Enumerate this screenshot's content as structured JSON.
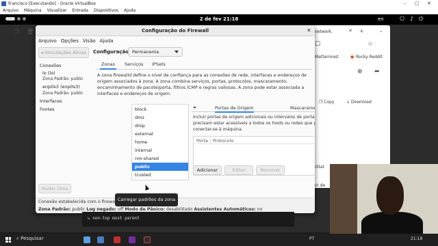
{
  "vbox": {
    "title": "Francisco [Executando] - Oracle VirtualBox",
    "menu": [
      "Arquivo",
      "Máquina",
      "Visualizar",
      "Entrada",
      "Dispositivos",
      "Ajuda"
    ],
    "controls": {
      "minimize": "–",
      "maximize": "▢",
      "close": "✕"
    }
  },
  "gnome": {
    "clock": "2 de fev  21:18",
    "keyboard": "en"
  },
  "browser": {
    "tab_title": "network.",
    "tab_close": "✕",
    "tab_add": "+",
    "tab_menu": "⌄",
    "bookmarks": [
      "Mattermost",
      "Rocky Reddit"
    ],
    "copy": "Copy",
    "download": "Download",
    "frag1": "eStat",
    "frag2": "air de"
  },
  "firewall": {
    "title": "Configuração do Firewall",
    "close": "✕",
    "menu": [
      "Arquivo",
      "Opções",
      "Visão",
      "Ajuda"
    ],
    "side": {
      "active_bindings": "Vinculações Ativas",
      "connections": "Conexões",
      "conn1": "lo (lo)",
      "conn1_sub": "Zona Padrão: public",
      "conn2": "enp0s3 (enp0s3)",
      "conn2_sub": "Zona Padrão: public",
      "interfaces": "Interfaces",
      "sources": "Fontes",
      "modify_zone": "Mudar Zona"
    },
    "config_label": "Configuração:",
    "config_value": "Permanente",
    "tabs": [
      "Zonas",
      "Serviços",
      "IPSets"
    ],
    "description": "A zona firewalld define o nível de confiança para as conexões de rede, interfaces e endereços de origem associados à zona. A zona combina serviços, portas, protocolos, mascaramento, encaminhamento de pacote/porta, filtros ICMP e regras valiosas. A zona pode estar associada a interfaces e endereços de origem.",
    "zones": [
      "block",
      "dmz",
      "drop",
      "external",
      "home",
      "internal",
      "nm-shared",
      "public",
      "trusted"
    ],
    "selected_zone": "public",
    "zone_tools": {
      "add": "+",
      "edit": "✎",
      "remove": "−",
      "load": "⬇"
    },
    "subtabs": {
      "left_arrow": "◂",
      "right_arrow": "▸",
      "source_ports": "Portas de Origem",
      "masquerade": "Mascaramento"
    },
    "port_desc": "Incluir portas de origem adicionais ou intervalos de portas que precisam estar acessíveis a todos os hosts ou redes que podem conectar-se à máquina.",
    "table_headers": [
      "Porta",
      "Protocolo"
    ],
    "buttons": {
      "add": "Adicionar",
      "edit": "Editar",
      "remove": "Remover"
    },
    "status_line1": "Conexão estabelecida com o firewall.",
    "status_line2": {
      "default_zone_label": "Zona Padrão:",
      "default_zone": "public",
      "log_label": "Log negado:",
      "log": "off",
      "panic_label": "Modo de Pânico:",
      "panic": "desabilitado",
      "auto_helpers_label": "Assistentes Automáticos:",
      "auto_helpers": "no"
    }
  },
  "tooltip": "Carregar padrões da zona",
  "terminal_line": "↳ non-top most parent",
  "taskbar": {
    "search": "Pesquisar",
    "lang": "PT",
    "time": "21:18"
  }
}
